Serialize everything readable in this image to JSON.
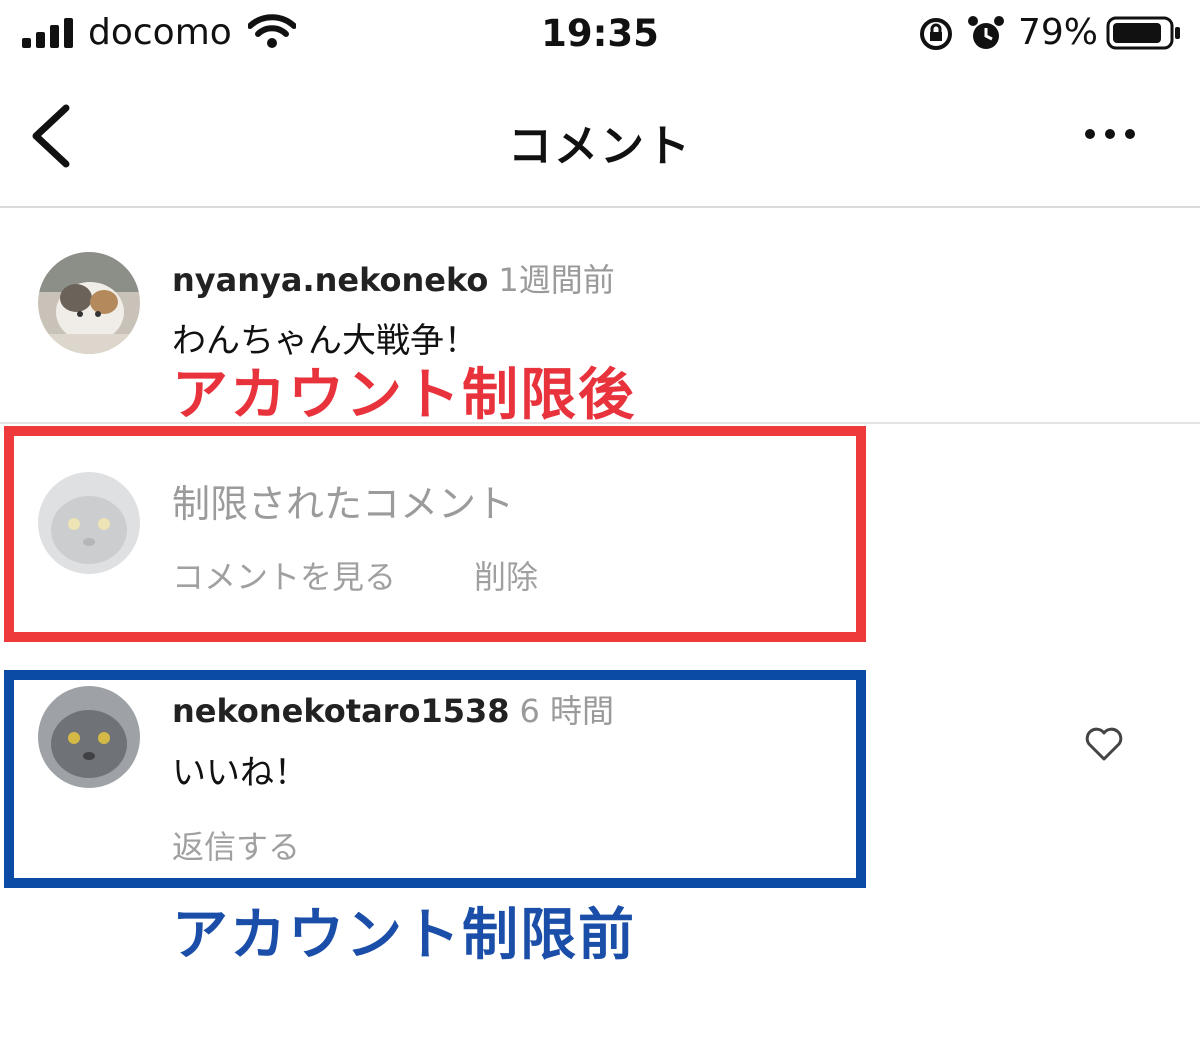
{
  "status_bar": {
    "carrier": "docomo",
    "time": "19:35",
    "battery_percent": "79%"
  },
  "nav": {
    "title": "コメント"
  },
  "comments": [
    {
      "username": "nyanya.nekoneko",
      "time_ago": "1週間前",
      "text": "わんちゃん大戦争！"
    },
    {
      "restricted_text": "制限されたコメント",
      "view_label": "コメントを見る",
      "delete_label": "削除"
    },
    {
      "username": "nekonekotaro1538",
      "time_ago": "6 時間",
      "text": "いいね！",
      "reply_label": "返信する"
    }
  ],
  "annotations": {
    "after": "アカウント制限後",
    "before": "アカウント制限前",
    "after_color": "#e8323c",
    "before_color": "#1a4ea8"
  },
  "icons": [
    "signal-icon",
    "wifi-icon",
    "orientation-lock-icon",
    "alarm-icon",
    "battery-icon",
    "back-chevron-icon",
    "more-icon",
    "heart-icon"
  ]
}
